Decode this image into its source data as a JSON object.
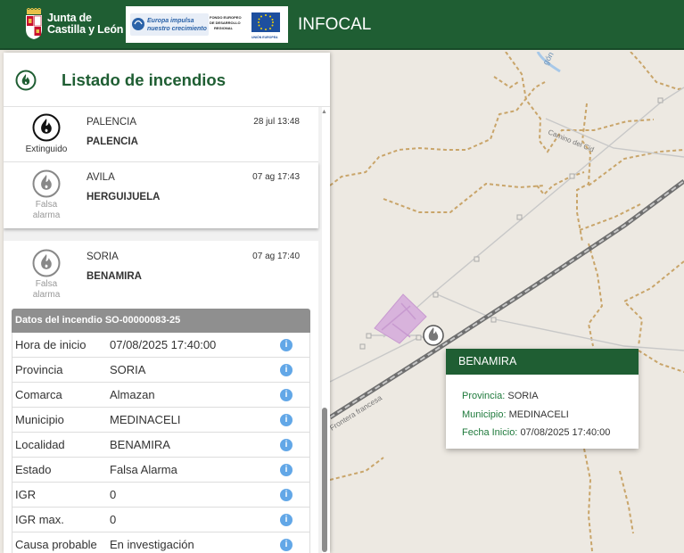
{
  "header": {
    "logo_line1": "Junta de",
    "logo_line2": "Castilla y León",
    "feder_text1": "Europa impulsa",
    "feder_text2": "nuestro crecimiento",
    "feder_fund1": "FONDO EUROPEO",
    "feder_fund2": "DE DESARROLLO",
    "feder_fund3": "REGIONAL",
    "feder_eu": "UNIÓN EUROPEA",
    "app_title": "INFOCAL"
  },
  "panel": {
    "title": "Listado de incendios"
  },
  "fires": [
    {
      "province": "PALENCIA",
      "location": "PALENCIA",
      "date": "28 jul 13:48",
      "status": "Extinguido"
    },
    {
      "province": "AVILA",
      "location": "HERGUIJUELA",
      "date": "07 ag 17:43",
      "status_line1": "Falsa",
      "status_line2": "alarma"
    },
    {
      "province": "SORIA",
      "location": "BENAMIRA",
      "date": "07 ag 17:40",
      "status_line1": "Falsa",
      "status_line2": "alarma"
    }
  ],
  "details": {
    "title": "Datos del incendio SO-00000083-25",
    "rows": [
      {
        "label": "Hora de inicio",
        "value": "07/08/2025 17:40:00"
      },
      {
        "label": "Provincia",
        "value": "SORIA"
      },
      {
        "label": "Comarca",
        "value": "Almazan"
      },
      {
        "label": "Municipio",
        "value": "MEDINACELI"
      },
      {
        "label": "Localidad",
        "value": "BENAMIRA"
      },
      {
        "label": "Estado",
        "value": "Falsa Alarma"
      },
      {
        "label": "IGR",
        "value": "0"
      },
      {
        "label": "IGR max.",
        "value": "0"
      },
      {
        "label": "Causa probable",
        "value": "En investigación"
      }
    ]
  },
  "map": {
    "label_road": "Camino del Cid",
    "label_border": "Frontera francesa",
    "label_water": "gón"
  },
  "popup": {
    "title": "BENAMIRA",
    "provincia_key": "Provincia:",
    "provincia_val": "SORIA",
    "municipio_key": "Municipio:",
    "municipio_val": "MEDINACELI",
    "fecha_key": "Fecha Inicio:",
    "fecha_val": "07/08/2025 17:40:00"
  },
  "colors": {
    "brand_green": "#1f5e33",
    "info_blue": "#62a7e7",
    "details_header_gray": "#8f8f8f"
  },
  "icons": {
    "fire_active": "fire-icon-black",
    "fire_false_alarm": "fire-icon-gray",
    "info": "info-icon"
  }
}
